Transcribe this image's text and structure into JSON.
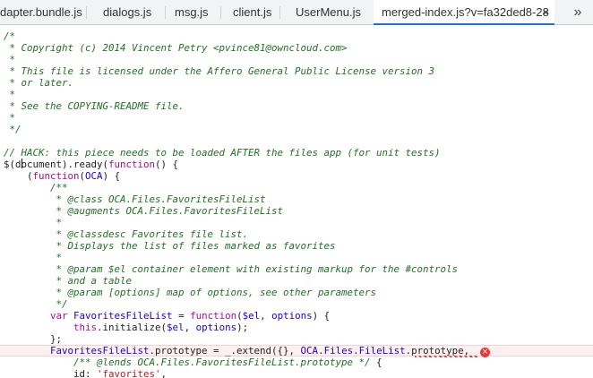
{
  "tabs": [
    {
      "label": "dapter.bundle.js",
      "active": false
    },
    {
      "label": "dialogs.js",
      "active": false
    },
    {
      "label": "msg.js",
      "active": false
    },
    {
      "label": "client.js",
      "active": false
    },
    {
      "label": "UserMenu.js",
      "active": false
    },
    {
      "label": "merged-index.js?v=fa32ded8-28",
      "active": true
    }
  ],
  "tab_close_glyph": "×",
  "overflow_glyph": "»",
  "error_glyph": "×",
  "code_lines": [
    [
      [
        "c",
        "/*"
      ]
    ],
    [
      [
        "c",
        " * Copyright (c) 2014 Vincent Petry <pvince81@owncloud.com>"
      ]
    ],
    [
      [
        "c",
        " *"
      ]
    ],
    [
      [
        "c",
        " * This file is licensed under the Affero General Public License version 3"
      ]
    ],
    [
      [
        "c",
        " * or later."
      ]
    ],
    [
      [
        "c",
        " *"
      ]
    ],
    [
      [
        "c",
        " * See the COPYING-README file."
      ]
    ],
    [
      [
        "c",
        " *"
      ]
    ],
    [
      [
        "c",
        " */"
      ]
    ],
    [],
    [
      [
        "c",
        "// HACK: this piece needs to be loaded AFTER the files app (for unit tests)"
      ]
    ],
    [
      [
        "p",
        "$(d"
      ],
      [
        "cursor",
        ""
      ],
      [
        "p",
        "ocument).ready("
      ],
      [
        "k",
        "function"
      ],
      [
        "p",
        "() {"
      ]
    ],
    [
      [
        "p",
        "    ("
      ],
      [
        "k",
        "function"
      ],
      [
        "p",
        "("
      ],
      [
        "v",
        "OCA"
      ],
      [
        "p",
        ") {"
      ]
    ],
    [
      [
        "p",
        "        "
      ],
      [
        "c",
        "/**"
      ]
    ],
    [
      [
        "c",
        "         * @class OCA.Files.FavoritesFileList"
      ]
    ],
    [
      [
        "c",
        "         * @augments OCA.Files.FavoritesFileList"
      ]
    ],
    [
      [
        "c",
        "         *"
      ]
    ],
    [
      [
        "c",
        "         * @classdesc Favorites file list."
      ]
    ],
    [
      [
        "c",
        "         * Displays the list of files marked as favorites"
      ]
    ],
    [
      [
        "c",
        "         *"
      ]
    ],
    [
      [
        "c",
        "         * @param $el container element with existing markup for the #controls"
      ]
    ],
    [
      [
        "c",
        "         * and a table"
      ]
    ],
    [
      [
        "c",
        "         * @param [options] map of options, see other parameters"
      ]
    ],
    [
      [
        "c",
        "         */"
      ]
    ],
    [
      [
        "p",
        "        "
      ],
      [
        "k",
        "var"
      ],
      [
        "p",
        " "
      ],
      [
        "v",
        "FavoritesFileList"
      ],
      [
        "p",
        " = "
      ],
      [
        "k",
        "function"
      ],
      [
        "p",
        "("
      ],
      [
        "v",
        "$el"
      ],
      [
        "p",
        ", "
      ],
      [
        "v",
        "options"
      ],
      [
        "p",
        ") {"
      ]
    ],
    [
      [
        "p",
        "            "
      ],
      [
        "k",
        "this"
      ],
      [
        "p",
        ".initialize("
      ],
      [
        "v",
        "$el"
      ],
      [
        "p",
        ", "
      ],
      [
        "v",
        "options"
      ],
      [
        "p",
        ");"
      ]
    ],
    [
      [
        "p",
        "        };"
      ]
    ],
    [
      [
        "p",
        "        "
      ],
      [
        "v",
        "FavoritesFileList"
      ],
      [
        "p",
        ".prototype = _.extend({}, "
      ],
      [
        "v",
        "OCA"
      ],
      [
        "p",
        "."
      ],
      [
        "v",
        "Files"
      ],
      [
        "p",
        "."
      ],
      [
        "v",
        "FileList"
      ],
      [
        "p",
        ".prototype,"
      ]
    ],
    [
      [
        "p",
        "            "
      ],
      [
        "c",
        "/** @lends OCA.Files.FavoritesFileList.prototype */"
      ],
      [
        "p",
        " {"
      ]
    ],
    [
      [
        "p",
        "            id: "
      ],
      [
        "s",
        "'favorites'"
      ],
      [
        "p",
        ","
      ]
    ]
  ],
  "error_line_index": 27
}
